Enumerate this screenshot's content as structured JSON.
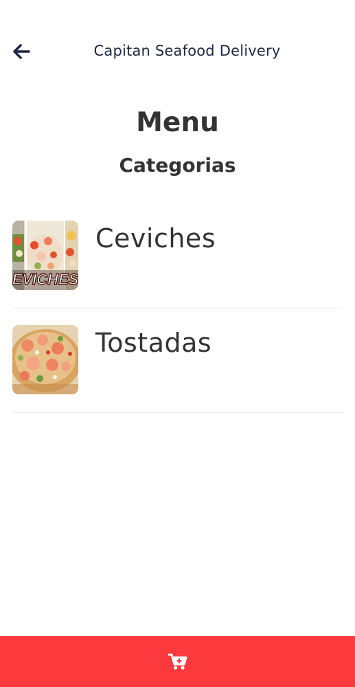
{
  "header": {
    "title": "Capitan Seafood Delivery",
    "back_icon": "arrow-left-icon"
  },
  "main": {
    "title": "Menu",
    "section_title": "Categorias",
    "categories": [
      {
        "label": "Ceviches",
        "thumb_text": "EVICHES",
        "image": "ceviche-photo"
      },
      {
        "label": "Tostadas",
        "image": "tostada-photo"
      }
    ]
  },
  "footer": {
    "cart_icon": "cart-plus-icon"
  },
  "colors": {
    "accent": "#fc3a3e",
    "header_text": "#1d2742",
    "body_text": "#333333"
  }
}
